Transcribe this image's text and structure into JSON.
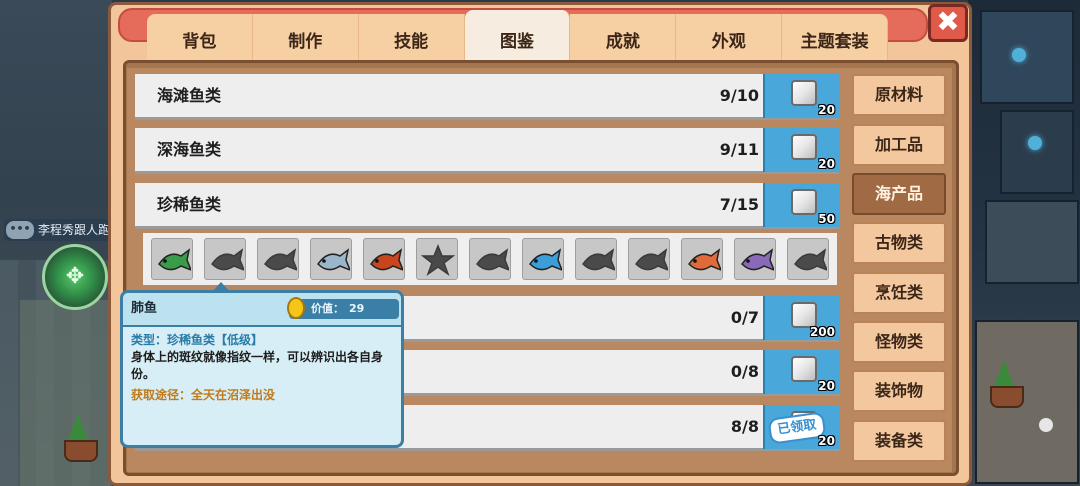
{
  "chat": {
    "icon": "•••",
    "text": "李程秀跟人跑"
  },
  "tabs": [
    {
      "label": "背包",
      "active": false
    },
    {
      "label": "制作",
      "active": false
    },
    {
      "label": "技能",
      "active": false
    },
    {
      "label": "图鉴",
      "active": true
    },
    {
      "label": "成就",
      "active": false
    },
    {
      "label": "外观",
      "active": false
    },
    {
      "label": "主题套装",
      "active": false
    }
  ],
  "close_label": "✖",
  "rows": [
    {
      "title": "海滩鱼类",
      "count": "9/10",
      "reward": "20",
      "claimed": false
    },
    {
      "title": "深海鱼类",
      "count": "9/11",
      "reward": "20",
      "claimed": false
    },
    {
      "title": "珍稀鱼类",
      "count": "7/15",
      "reward": "50",
      "claimed": false
    },
    {
      "title": "",
      "count": "0/7",
      "reward": "200",
      "claimed": false
    },
    {
      "title": "",
      "count": "0/8",
      "reward": "20",
      "claimed": false
    },
    {
      "title": "",
      "count": "8/8",
      "reward": "20",
      "claimed": true,
      "claimed_label": "已领取"
    }
  ],
  "fish": [
    {
      "icon": "lungfish-icon",
      "discovered": true,
      "color": "#3a9b4a"
    },
    {
      "icon": "unknown-fish-icon",
      "discovered": false
    },
    {
      "icon": "unknown-fish-icon",
      "discovered": false
    },
    {
      "icon": "fish-icon",
      "discovered": true,
      "color": "#9ab6c8"
    },
    {
      "icon": "lobster-icon",
      "discovered": true,
      "color": "#c8451e"
    },
    {
      "icon": "unknown-star-icon",
      "discovered": false
    },
    {
      "icon": "unknown-fish-icon",
      "discovered": false
    },
    {
      "icon": "fish-icon",
      "discovered": true,
      "color": "#3a9fd6"
    },
    {
      "icon": "unknown-fish-icon",
      "discovered": false
    },
    {
      "icon": "unknown-fish-icon",
      "discovered": false
    },
    {
      "icon": "fish-icon",
      "discovered": true,
      "color": "#e06a3a"
    },
    {
      "icon": "fish-icon",
      "discovered": true,
      "color": "#8a6ab8"
    },
    {
      "icon": "unknown-fish-icon",
      "discovered": false
    }
  ],
  "tooltip": {
    "name": "肺鱼",
    "value_label": "价值：",
    "value": "29",
    "type": "类型：珍稀鱼类【低级】",
    "description": "身体上的斑纹就像指纹一样，可以辨识出各自身份。",
    "source": "获取途径：全天在沼泽出没"
  },
  "sidebar": [
    {
      "label": "原材料",
      "active": false
    },
    {
      "label": "加工品",
      "active": false
    },
    {
      "label": "海产品",
      "active": true
    },
    {
      "label": "古物类",
      "active": false
    },
    {
      "label": "烹饪类",
      "active": false
    },
    {
      "label": "怪物类",
      "active": false
    },
    {
      "label": "装饰物",
      "active": false
    },
    {
      "label": "装备类",
      "active": false
    }
  ],
  "colors": {
    "accent_blue": "#4aa7d9",
    "panel": "#f2c59a",
    "active_sidebar": "#a06a44"
  }
}
